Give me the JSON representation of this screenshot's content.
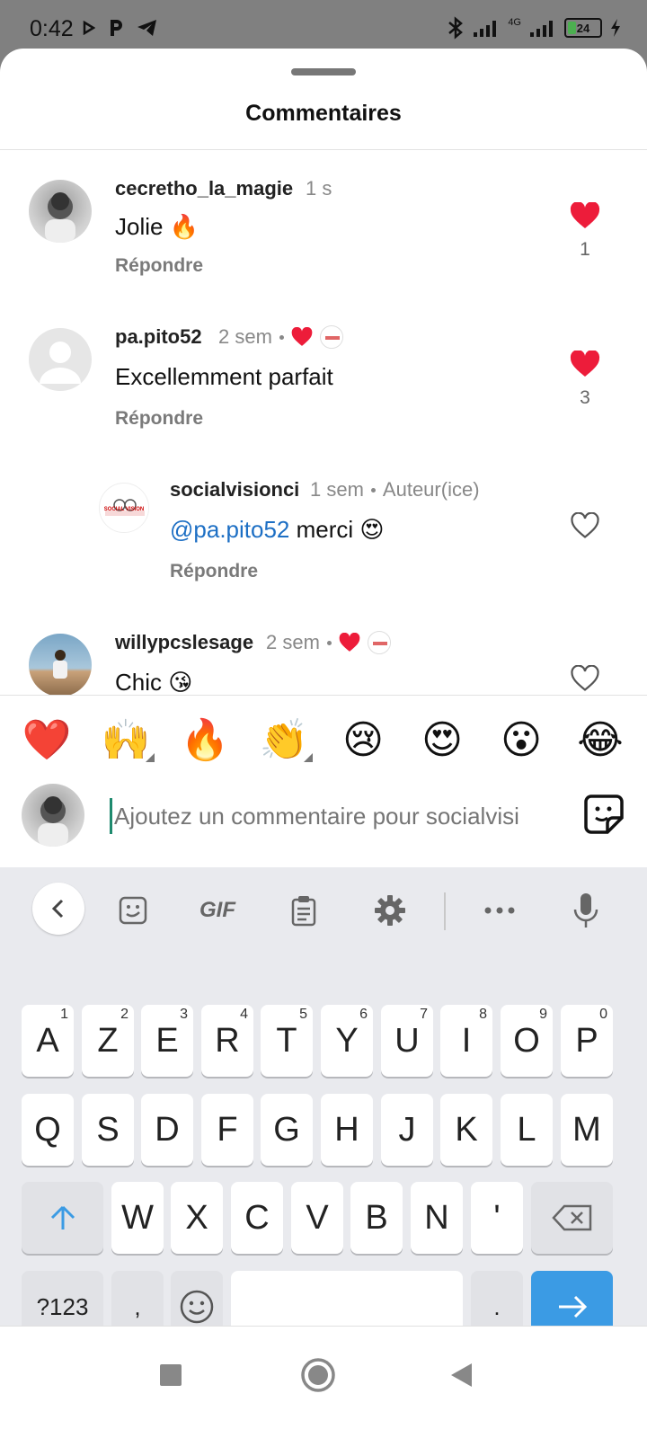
{
  "status_bar": {
    "time": "0:42",
    "network": "4G",
    "battery": "24"
  },
  "sheet": {
    "title": "Commentaires"
  },
  "comments": [
    {
      "username": "cecretho_la_magie",
      "time": "1 s",
      "text": "Jolie 🔥",
      "reply_label": "Répondre",
      "likes": "1",
      "liked": true
    },
    {
      "username": "pa.pito52",
      "time": "2 sem",
      "text": "Excellemment parfait",
      "reply_label": "Répondre",
      "likes": "3",
      "liked": true,
      "author_liked": true
    },
    {
      "username": "socialvisionci",
      "time": "1 sem",
      "author_badge": "Auteur(ice)",
      "mention": "@pa.pito52",
      "text": " merci 😍",
      "reply_label": "Répondre",
      "liked": false,
      "avatar_text": "SOCIAL VISION"
    },
    {
      "username": "willypcslesage",
      "time": "2 sem",
      "text": "Chic 😘",
      "liked": false,
      "author_liked": true
    }
  ],
  "emoji_bar": [
    "❤️",
    "🙌",
    "🔥",
    "👏",
    "😢",
    "😍",
    "😮",
    "😂"
  ],
  "comment_input": {
    "placeholder": "Ajoutez un commentaire pour socialvisi"
  },
  "keyboard": {
    "toolbar": [
      "back-icon",
      "sticker-icon",
      "GIF",
      "clipboard-icon",
      "settings-icon",
      "more-icon",
      "mic-icon"
    ],
    "gif_label": "GIF",
    "row1": [
      {
        "key": "A",
        "hint": "1"
      },
      {
        "key": "Z",
        "hint": "2"
      },
      {
        "key": "E",
        "hint": "3"
      },
      {
        "key": "R",
        "hint": "4"
      },
      {
        "key": "T",
        "hint": "5"
      },
      {
        "key": "Y",
        "hint": "6"
      },
      {
        "key": "U",
        "hint": "7"
      },
      {
        "key": "I",
        "hint": "8"
      },
      {
        "key": "O",
        "hint": "9"
      },
      {
        "key": "P",
        "hint": "0"
      }
    ],
    "row2": [
      "Q",
      "S",
      "D",
      "F",
      "G",
      "H",
      "J",
      "K",
      "L",
      "M"
    ],
    "row3": [
      "W",
      "X",
      "C",
      "V",
      "B",
      "N",
      "'"
    ],
    "symbols_label": "?123",
    "comma_label": ",",
    "period_label": "."
  },
  "colors": {
    "like_red": "#ed1c3a",
    "mention_blue": "#1d6fc4",
    "enter_blue": "#3b9be4"
  }
}
